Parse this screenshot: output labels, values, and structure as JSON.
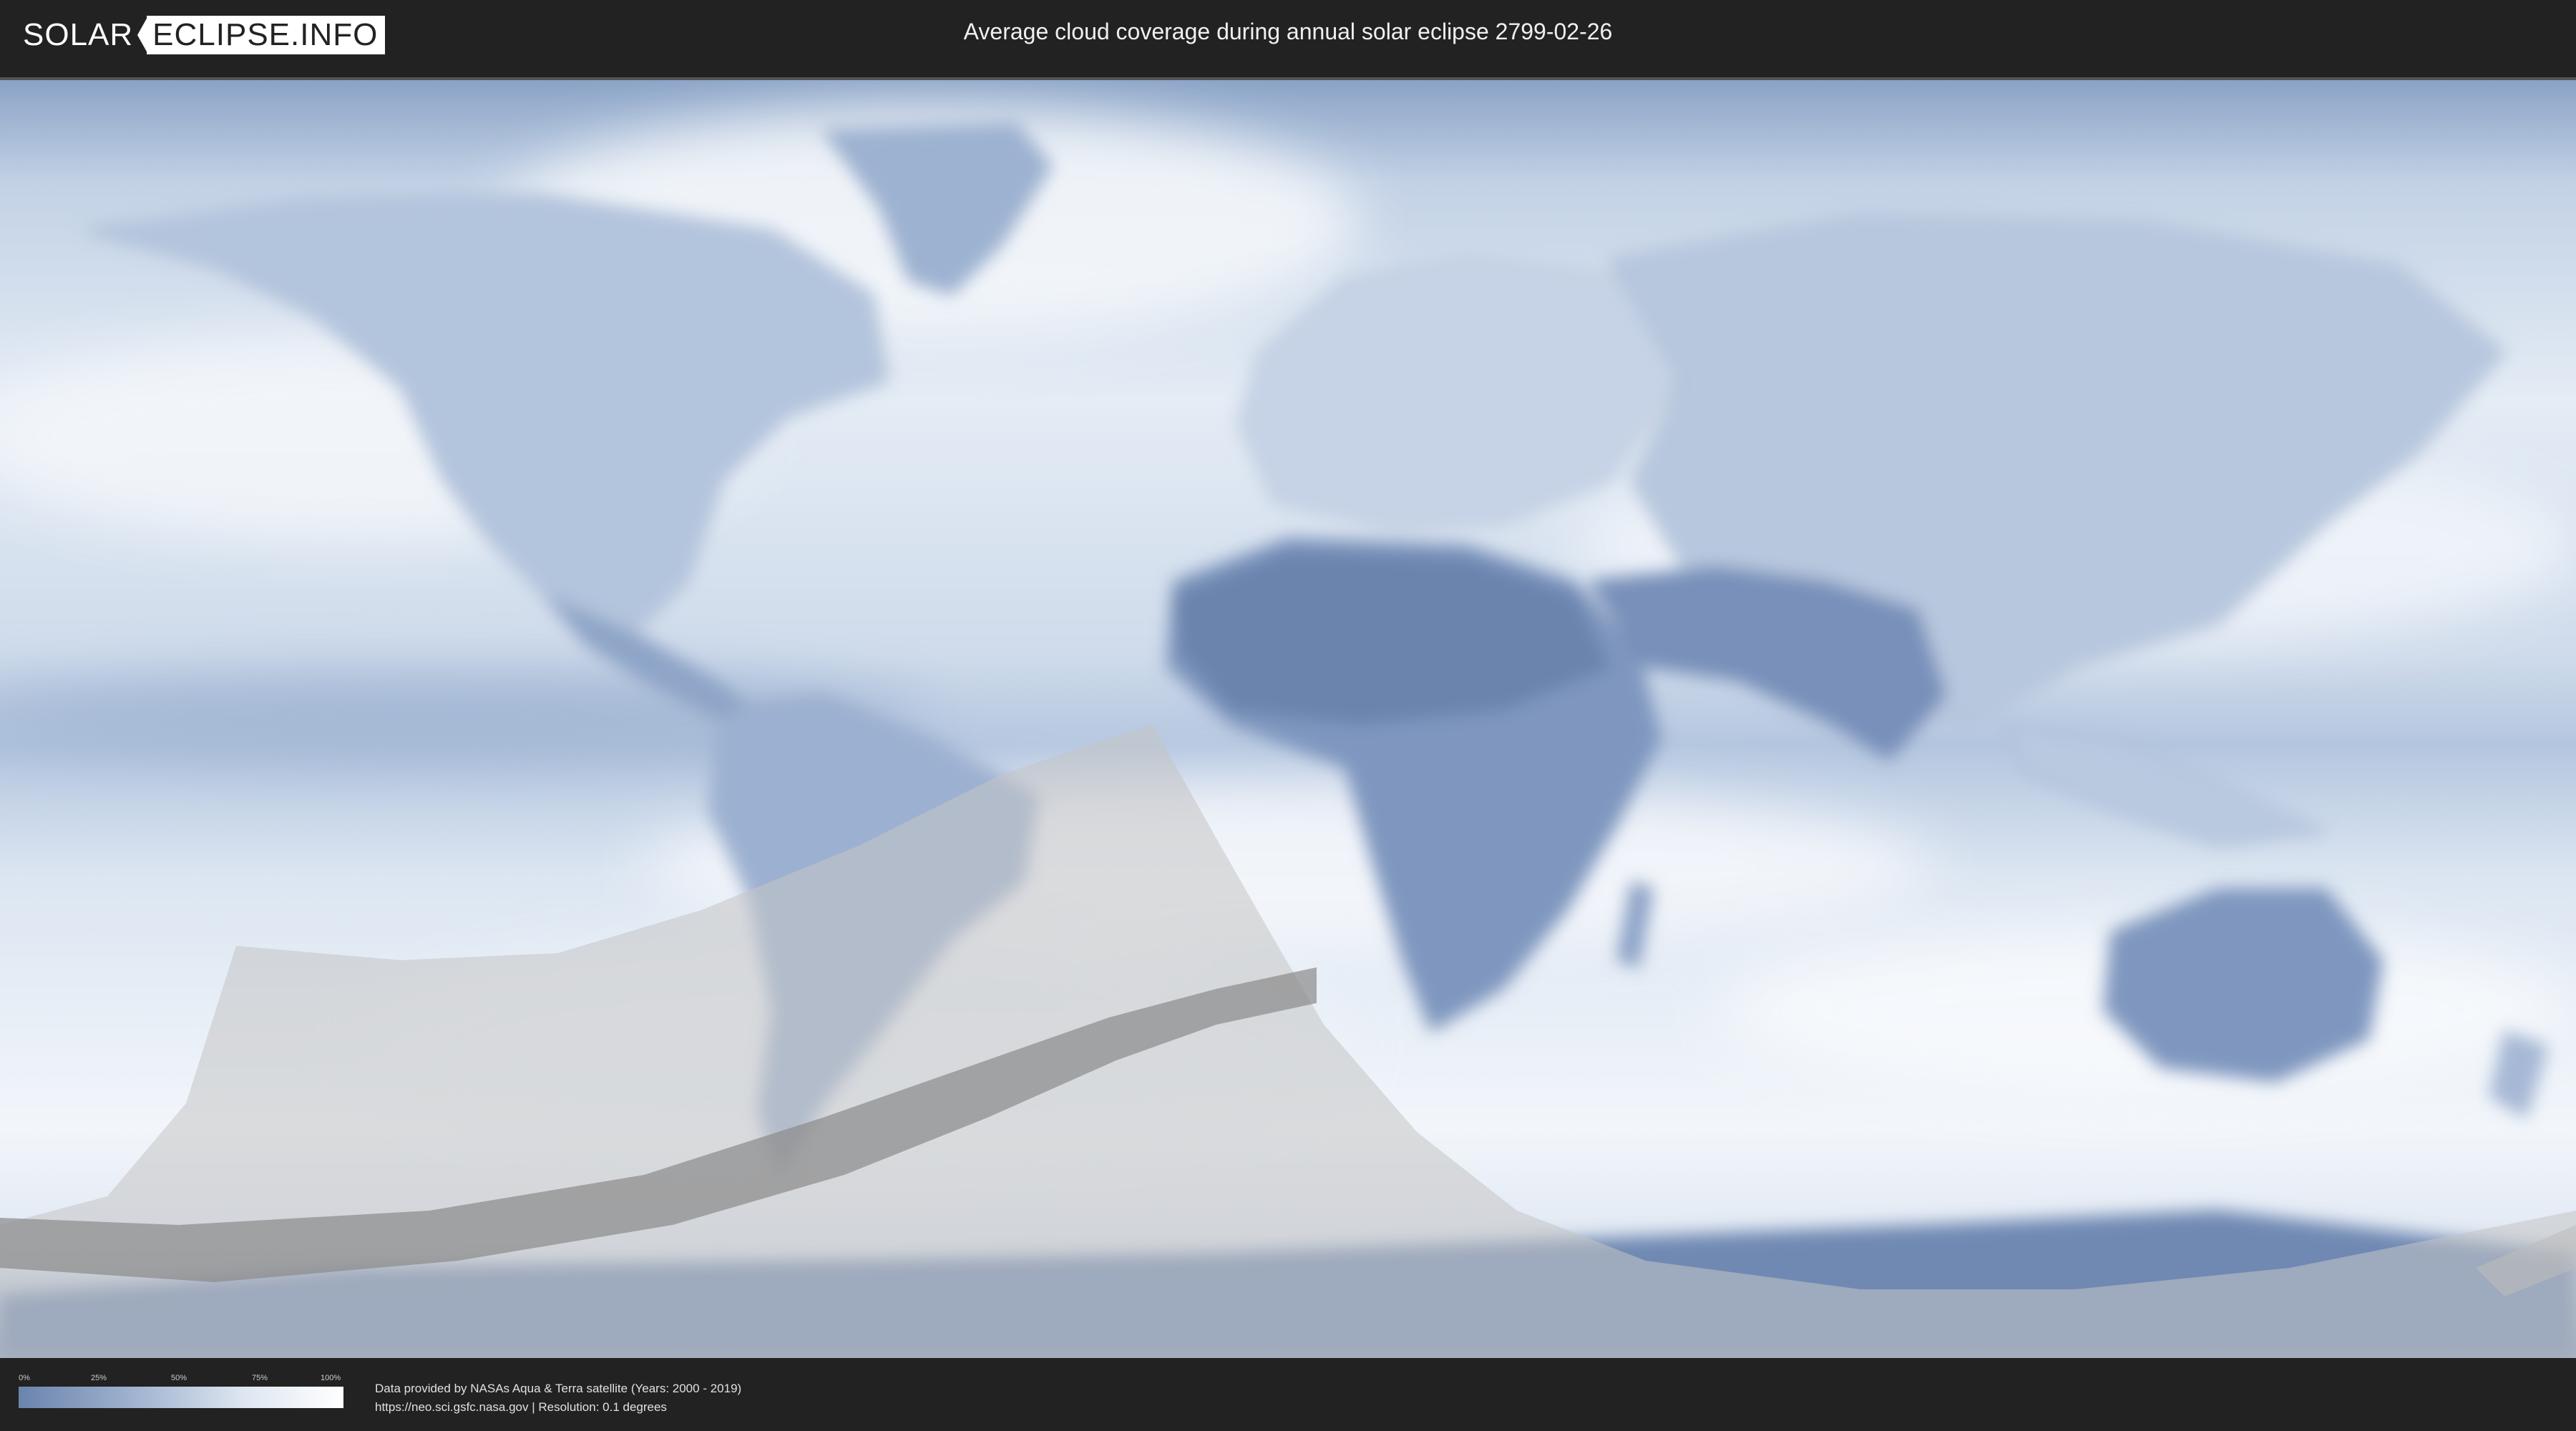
{
  "header": {
    "logo_left": "SOLAR",
    "logo_right": "ECLIPSE.INFO",
    "title": "Average cloud coverage during annual solar eclipse 2799-02-26"
  },
  "legend": {
    "ticks": [
      "0%",
      "25%",
      "50%",
      "75%",
      "100%"
    ],
    "color_low": "#6b84ad",
    "color_high": "#ffffff"
  },
  "credits": {
    "line1": "Data provided by NASAs Aqua & Terra satellite (Years: 2000 - 2019)",
    "line2": "https://neo.sci.gsfc.nasa.gov | Resolution: 0.1 degrees"
  },
  "colors": {
    "background": "#222222",
    "ocean_clouds": "#c9d6e8",
    "land_clear": "#5f7aa6",
    "eclipse_shadow": "#bfbfbf",
    "annular_path": "#8a8a8a"
  }
}
